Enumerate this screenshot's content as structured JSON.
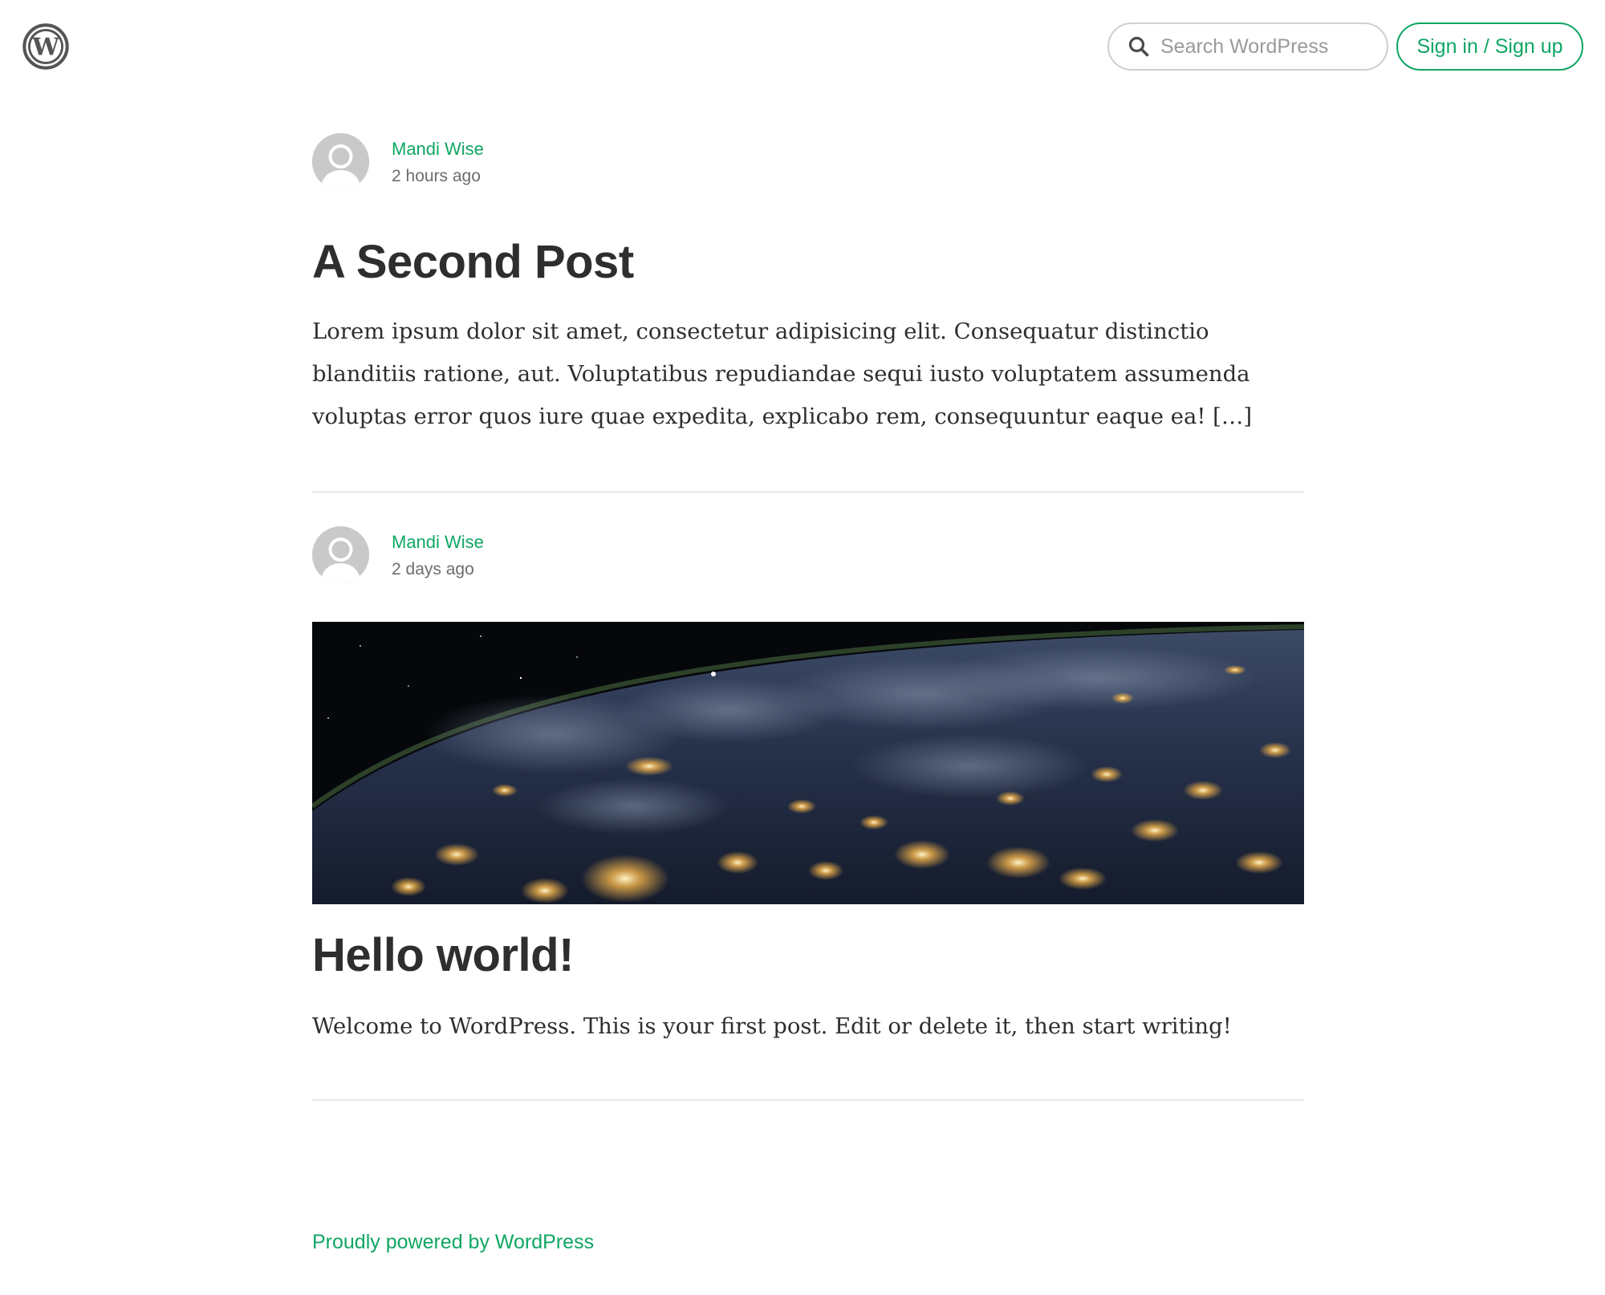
{
  "header": {
    "logo_icon": "wordpress-logo-icon",
    "search": {
      "icon": "search-icon",
      "placeholder": "Search WordPress",
      "value": ""
    },
    "signin_label": "Sign in / Sign up"
  },
  "posts": [
    {
      "author": "Mandi Wise",
      "time": "2 hours ago",
      "avatar_icon": "default-avatar-icon",
      "title": "A Second Post",
      "excerpt": "Lorem ipsum dolor sit amet, consectetur adipisicing elit. Consequatur distinctio blanditiis ratione, aut. Voluptatibus repudiandae sequi iusto voluptatem assumenda voluptas error quos iure quae expedita, explicabo rem, consequuntur eaque ea! […]"
    },
    {
      "author": "Mandi Wise",
      "time": "2 days ago",
      "avatar_icon": "default-avatar-icon",
      "featured_image": "earth-at-night-from-space",
      "title": "Hello world!",
      "excerpt": "Welcome to WordPress. This is your first post. Edit or delete it, then start writing!"
    }
  ],
  "footer": {
    "link_label": "Proudly powered by WordPress"
  },
  "colors": {
    "accent": "#0fa663",
    "text": "#2e2e2e",
    "muted": "#6d6d6d",
    "divider": "#e6e6e6",
    "icon_gray": "#555555"
  }
}
